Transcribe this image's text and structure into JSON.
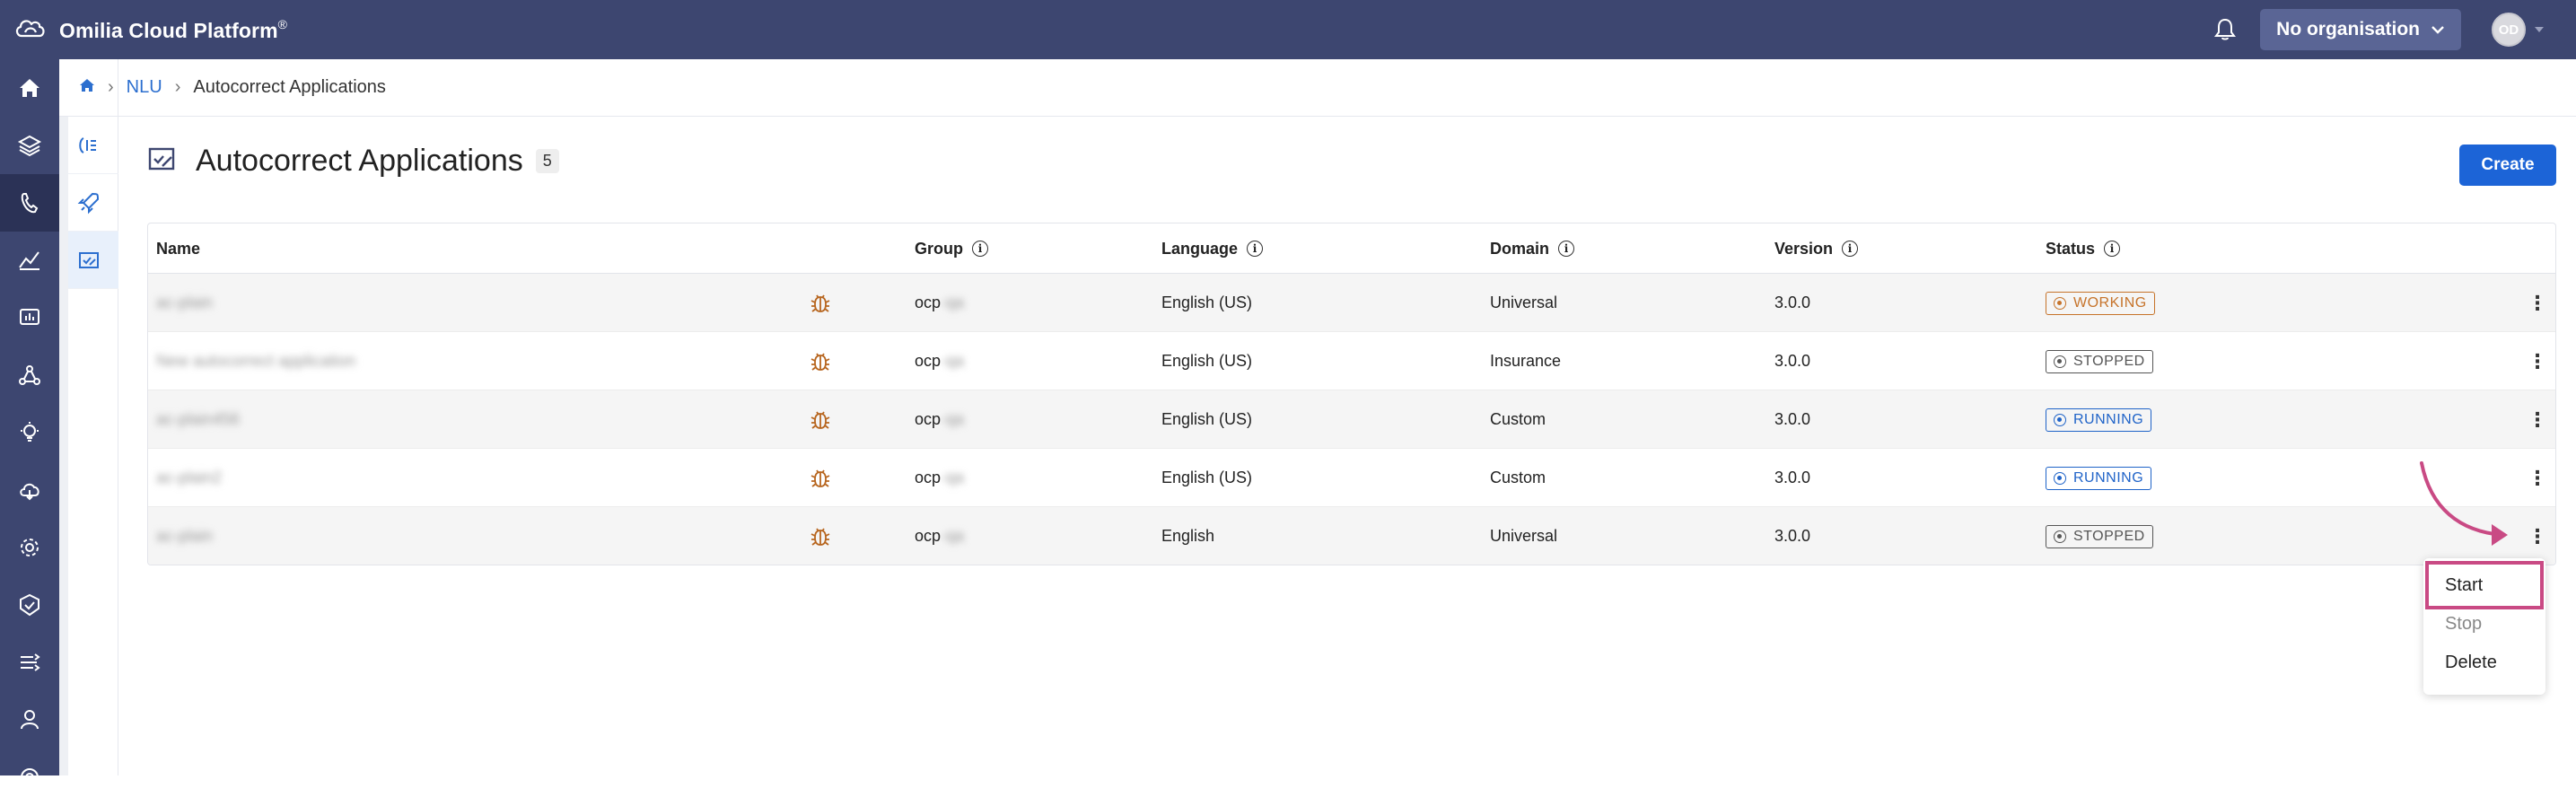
{
  "topbar": {
    "brand_name": "Omilia Cloud Platform",
    "brand_mark": "®",
    "org_label": "No organisation",
    "avatar_initials": "OD"
  },
  "breadcrumb": {
    "section": "NLU",
    "current": "Autocorrect Applications"
  },
  "page": {
    "title": "Autocorrect Applications",
    "count": "5",
    "create_label": "Create"
  },
  "table": {
    "headers": {
      "name": "Name",
      "group": "Group",
      "language": "Language",
      "domain": "Domain",
      "version": "Version",
      "status": "Status"
    },
    "rows": [
      {
        "name": "ac-plain",
        "group": "ocp",
        "group_suffix": "-qa",
        "language": "English (US)",
        "domain": "Universal",
        "version": "3.0.0",
        "status": "WORKING",
        "status_kind": "working"
      },
      {
        "name": "New autocorrect application",
        "group": "ocp",
        "group_suffix": "-qa",
        "language": "English (US)",
        "domain": "Insurance",
        "version": "3.0.0",
        "status": "STOPPED",
        "status_kind": "stopped"
      },
      {
        "name": "ac-plain456",
        "group": "ocp",
        "group_suffix": "-qa",
        "language": "English (US)",
        "domain": "Custom",
        "version": "3.0.0",
        "status": "RUNNING",
        "status_kind": "running"
      },
      {
        "name": "ac-plain2",
        "group": "ocp",
        "group_suffix": "-qa",
        "language": "English (US)",
        "domain": "Custom",
        "version": "3.0.0",
        "status": "RUNNING",
        "status_kind": "running"
      },
      {
        "name": "ac-plain",
        "group": "ocp",
        "group_suffix": "-qa",
        "language": "English",
        "domain": "Universal",
        "version": "3.0.0",
        "status": "STOPPED",
        "status_kind": "stopped"
      }
    ]
  },
  "menu": {
    "start": "Start",
    "stop": "Stop",
    "delete": "Delete"
  },
  "colors": {
    "topbar": "#3d4670",
    "primary": "#1c64d7",
    "working": "#c6732a",
    "running": "#1f63c8",
    "highlight": "#c94a84"
  }
}
